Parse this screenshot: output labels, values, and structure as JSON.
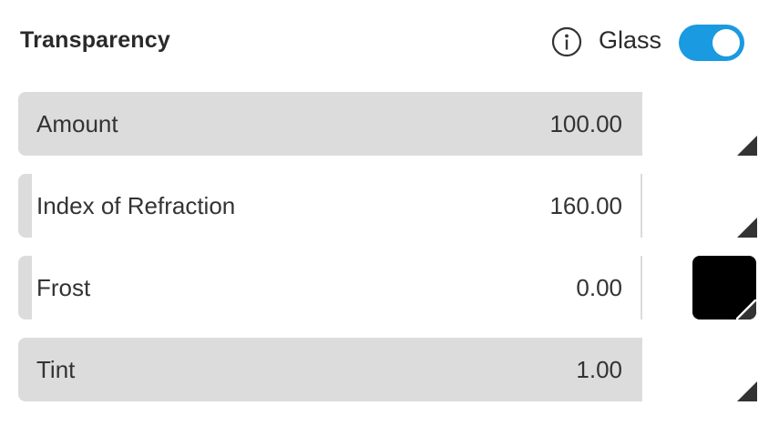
{
  "panel": {
    "title": "Transparency",
    "info_icon": "info-circle-icon",
    "glass": {
      "label": "Glass",
      "enabled": true,
      "color": "#1a9ae0"
    }
  },
  "rows": [
    {
      "label": "Amount",
      "value": "100.00",
      "fill": 1.0
    },
    {
      "label": "Index of Refraction",
      "value": "160.00",
      "fill": 0.0
    },
    {
      "label": "Frost",
      "value": "0.00",
      "fill": 0.0
    },
    {
      "label": "Tint",
      "value": "1.00",
      "fill": 1.0
    }
  ],
  "frost_swatch_color": "#000000"
}
